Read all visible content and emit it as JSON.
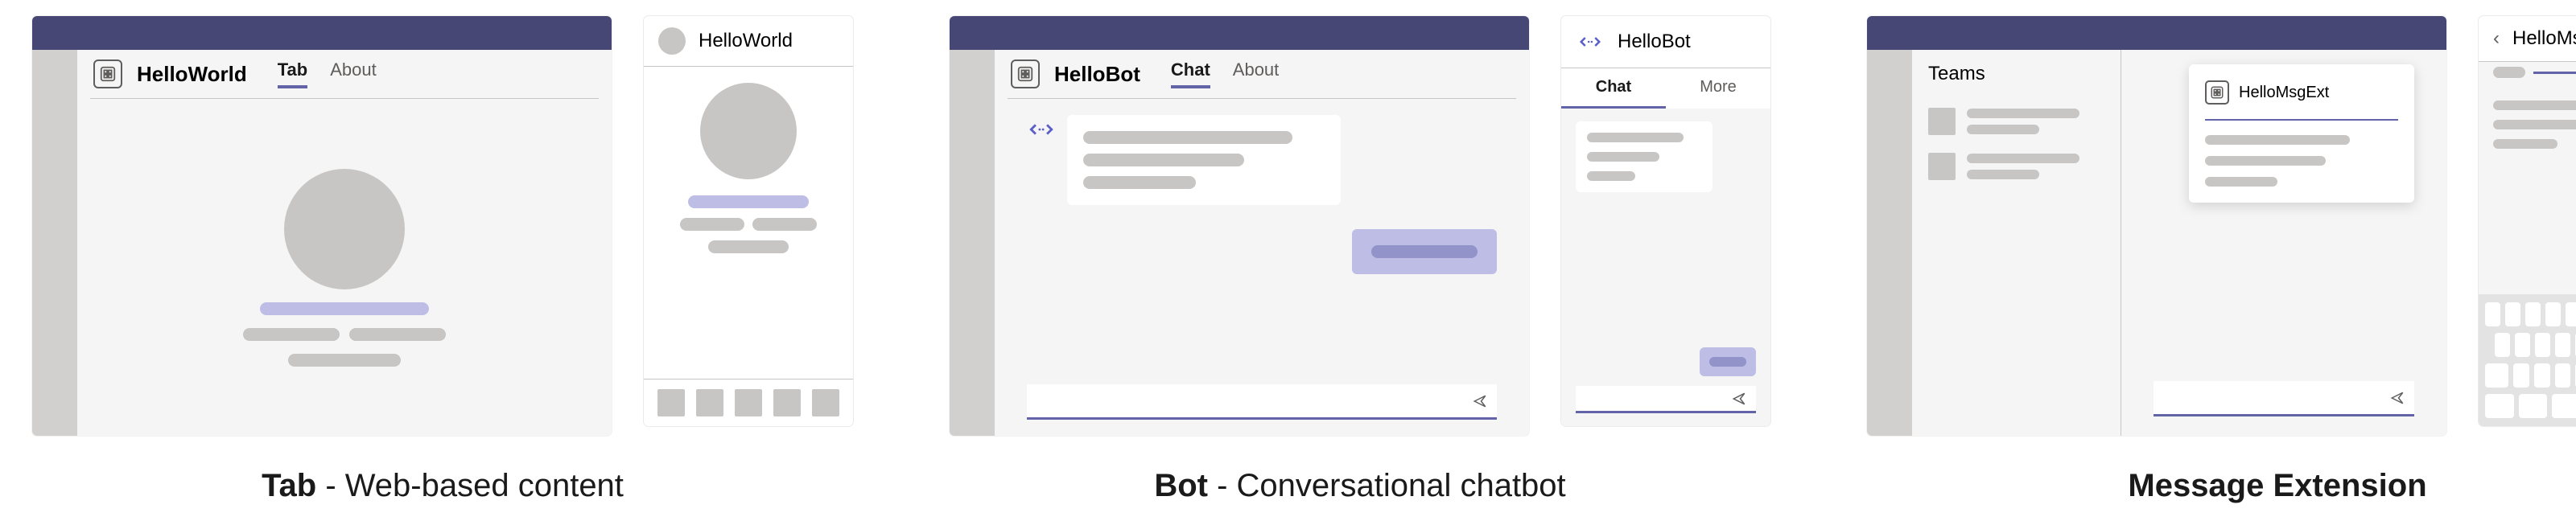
{
  "groups": [
    {
      "caption_bold": "Tab",
      "caption_rest": " - Web-based content",
      "desktop": {
        "app_name": "HelloWorld",
        "tabs": [
          {
            "label": "Tab",
            "active": true
          },
          {
            "label": "About",
            "active": false
          }
        ]
      },
      "mobile": {
        "title": "HelloWorld"
      }
    },
    {
      "caption_bold": "Bot",
      "caption_rest": " - Conversational chatbot",
      "desktop": {
        "app_name": "HelloBot",
        "tabs": [
          {
            "label": "Chat",
            "active": true
          },
          {
            "label": "About",
            "active": false
          }
        ]
      },
      "mobile": {
        "title": "HelloBot",
        "tabs": [
          {
            "label": "Chat",
            "active": true
          },
          {
            "label": "More",
            "active": false
          }
        ]
      }
    },
    {
      "caption_bold": "Message Extension",
      "caption_rest": "",
      "desktop": {
        "left_title": "Teams",
        "card_title": "HelloMsgExt"
      },
      "mobile": {
        "title": "HelloMsgExt"
      }
    }
  ]
}
